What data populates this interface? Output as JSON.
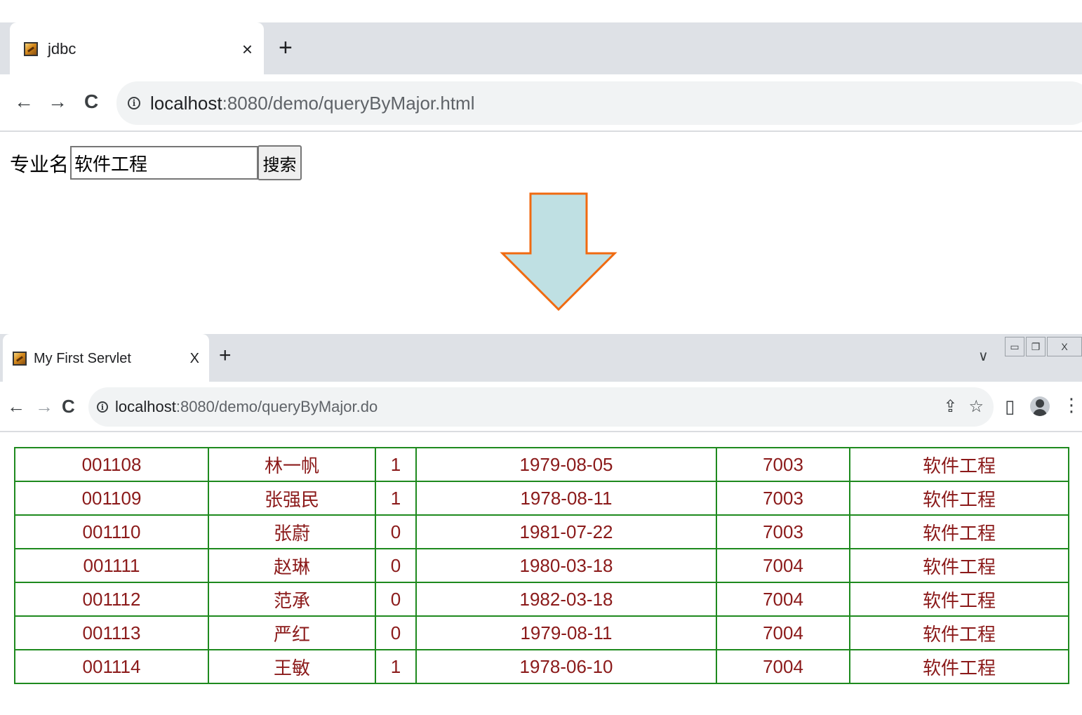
{
  "browser1": {
    "tab_title": "jdbc",
    "tab_close": "×",
    "new_tab": "+",
    "back": "←",
    "forward": "→",
    "reload": "C",
    "url_host": "localhost",
    "url_rest": ":8080/demo/queryByMajor.html"
  },
  "form": {
    "label": "专业名:",
    "major_value": "软件工程",
    "search_label": "搜索"
  },
  "browser2": {
    "tab_title": "My First Servlet",
    "tab_close": "X",
    "new_tab": "+",
    "tab_search": "∨",
    "minimize": "▭",
    "restore": "❐",
    "close": "X",
    "back": "←",
    "forward": "→",
    "reload": "C",
    "url_host": "localhost",
    "url_rest": ":8080/demo/queryByMajor.do",
    "share": "⇪",
    "bookmark": "☆",
    "side_panel": "▯",
    "menu": "⋮"
  },
  "colors": {
    "arrow_fill": "#bfe0e3",
    "arrow_stroke": "#f06a10",
    "table_border": "#1e8a1e",
    "table_text": "#8b1a1a"
  },
  "results": {
    "rows": [
      [
        "001108",
        "林一帆",
        "1",
        "1979-08-05",
        "7003",
        "软件工程"
      ],
      [
        "001109",
        "张强民",
        "1",
        "1978-08-11",
        "7003",
        "软件工程"
      ],
      [
        "001110",
        "张蔚",
        "0",
        "1981-07-22",
        "7003",
        "软件工程"
      ],
      [
        "001111",
        "赵琳",
        "0",
        "1980-03-18",
        "7004",
        "软件工程"
      ],
      [
        "001112",
        "范承",
        "0",
        "1982-03-18",
        "7004",
        "软件工程"
      ],
      [
        "001113",
        "严红",
        "0",
        "1979-08-11",
        "7004",
        "软件工程"
      ],
      [
        "001114",
        "王敏",
        "1",
        "1978-06-10",
        "7004",
        "软件工程"
      ]
    ]
  }
}
